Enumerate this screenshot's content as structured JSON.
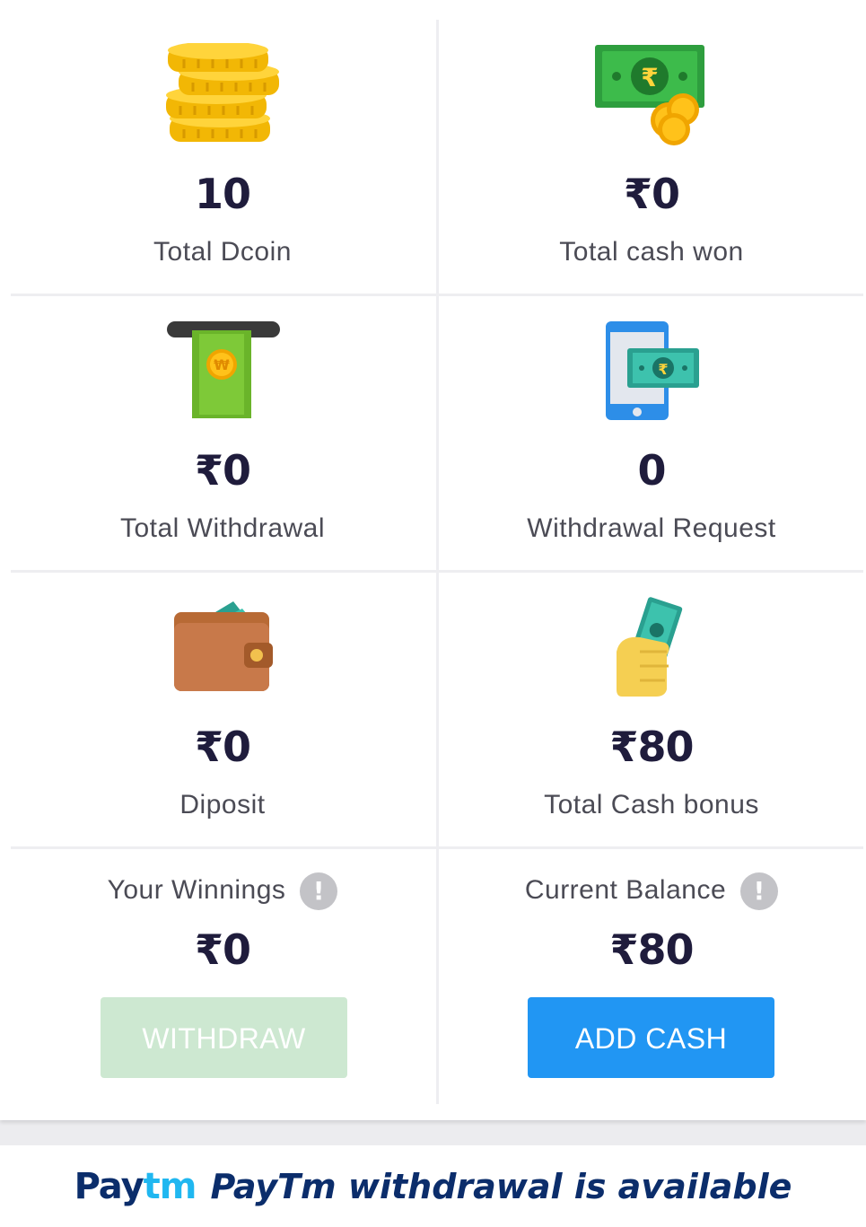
{
  "stats": {
    "dcoin": {
      "value": "10",
      "label": "Total Dcoin"
    },
    "cash_won": {
      "value": "₹0",
      "label": "Total cash won"
    },
    "withdrawal": {
      "value": "₹0",
      "label": "Total Withdrawal"
    },
    "withdrawal_request": {
      "value": "0",
      "label": "Withdrawal Request"
    },
    "deposit": {
      "value": "₹0",
      "label": "Diposit"
    },
    "cash_bonus": {
      "value": "₹80",
      "label": "Total Cash bonus"
    }
  },
  "winnings": {
    "label": "Your Winnings",
    "value": "₹0",
    "button_label": "WITHDRAW",
    "info_icon": "!"
  },
  "balance": {
    "label": "Current Balance",
    "value": "₹80",
    "button_label": "ADD CASH",
    "info_icon": "!"
  },
  "banner": {
    "logo_pay": "Pay",
    "logo_tm": "tm",
    "text": "PayTm withdrawal is available"
  },
  "icons": {
    "dcoin": "coin-stack-icon",
    "cash_won": "cash-note-coins-icon",
    "withdrawal": "atm-withdraw-icon",
    "withdrawal_request": "phone-cash-icon",
    "deposit": "wallet-icon",
    "cash_bonus": "hand-cash-icon",
    "info": "info-icon"
  },
  "colors": {
    "accent": "#2196f3",
    "withdraw_disabled": "#cde8d1",
    "brand_dark": "#0b2d6b",
    "brand_light": "#20b7f0"
  }
}
